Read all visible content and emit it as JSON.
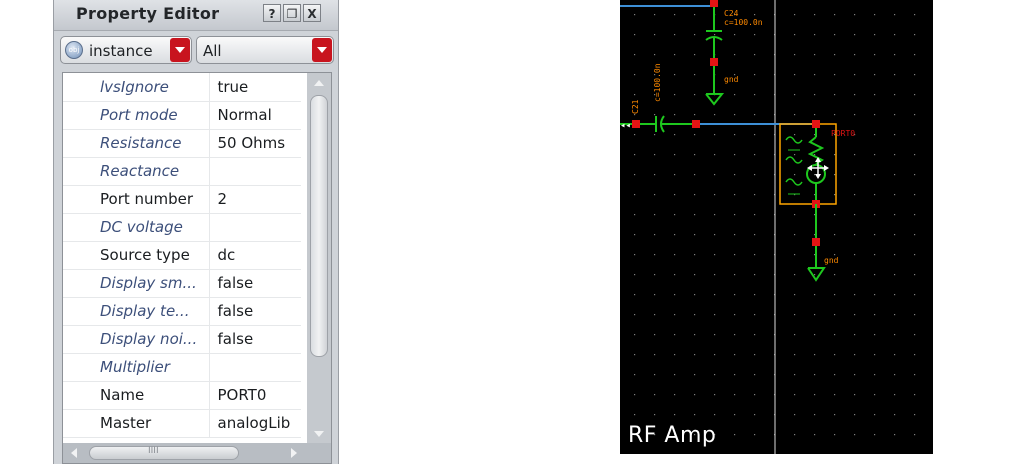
{
  "property_editor": {
    "title": "Property Editor",
    "title_buttons": {
      "help": "?",
      "float": "❐",
      "close": "X"
    },
    "object_type_combo": {
      "icon": "obj",
      "value": "instance"
    },
    "filter_combo": {
      "value": "All"
    },
    "properties": [
      {
        "name": "lvsIgnore",
        "value": "true",
        "italic": true
      },
      {
        "name": "Port mode",
        "value": "Normal",
        "italic": true
      },
      {
        "name": "Resistance",
        "value": "50 Ohms",
        "italic": true
      },
      {
        "name": "Reactance",
        "value": "",
        "italic": true
      },
      {
        "name": "Port number",
        "value": "2",
        "italic": false
      },
      {
        "name": "DC voltage",
        "value": "",
        "italic": true
      },
      {
        "name": "Source type",
        "value": "dc",
        "italic": false
      },
      {
        "name": "Display sm...",
        "value": "false",
        "italic": true
      },
      {
        "name": "Display te...",
        "value": "false",
        "italic": true
      },
      {
        "name": "Display noi...",
        "value": "false",
        "italic": true
      },
      {
        "name": "Multiplier",
        "value": "",
        "italic": true
      },
      {
        "name": "Name",
        "value": "PORT0",
        "italic": false
      },
      {
        "name": "Master",
        "value": "analogLib",
        "italic": false
      }
    ],
    "hscroll_grip": "IIII"
  },
  "schematic": {
    "label": "RF Amp",
    "instances": {
      "c24_name": "C24",
      "c24_value": "c=100.0n",
      "c24_gnd": "gnd",
      "c21_name": "C21",
      "c21_value": "c=100.0n",
      "port_name": "PORT0",
      "port_gnd": "gnd"
    },
    "colors": {
      "background": "#000000",
      "wire": "#3d8fd6",
      "component": "#1ec81e",
      "pin": "#e41414",
      "label": "#ff8a00",
      "selection": "#ffa600",
      "grid_dot": "#7f7f7f"
    }
  }
}
